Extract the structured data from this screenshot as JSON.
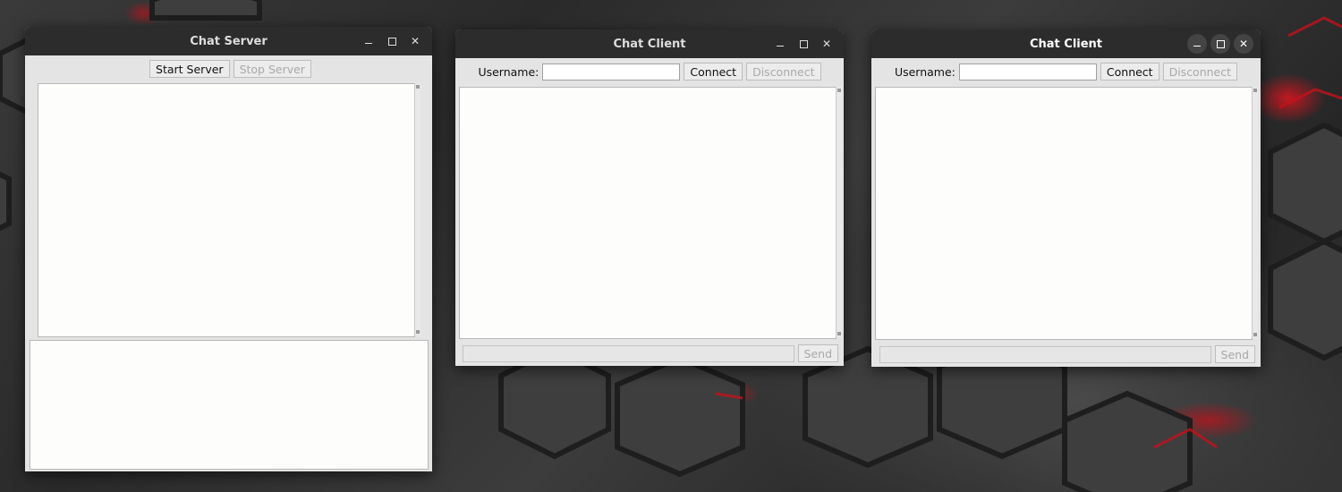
{
  "server": {
    "title": "Chat Server",
    "start_label": "Start Server",
    "stop_label": "Stop Server"
  },
  "client1": {
    "title": "Chat Client",
    "username_label": "Username:",
    "username_value": "",
    "connect_label": "Connect",
    "disconnect_label": "Disconnect",
    "send_label": "Send"
  },
  "client2": {
    "title": "Chat Client",
    "username_label": "Username:",
    "username_value": "",
    "connect_label": "Connect",
    "disconnect_label": "Disconnect",
    "send_label": "Send"
  },
  "window_controls": {
    "minimize": "minimize-icon",
    "maximize": "maximize-icon",
    "close": "close-icon"
  },
  "colors": {
    "titlebar": "#2c2c2c",
    "window_bg": "#e4e4e4",
    "text_area": "#fdfdfb",
    "desktop_accent": "#d0141e"
  }
}
